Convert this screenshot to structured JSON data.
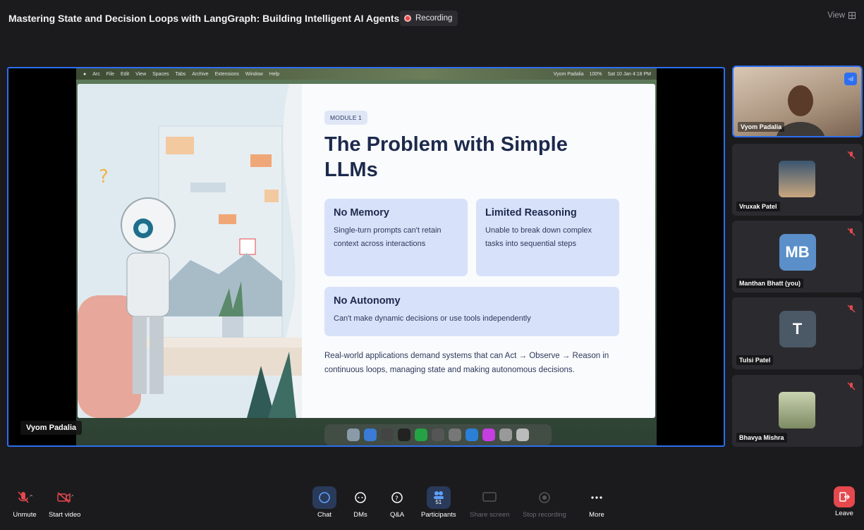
{
  "meeting": {
    "title": "Mastering State and Decision Loops with LangGraph: Building Intelligent AI Agents",
    "recording_label": "Recording",
    "view_label": "View"
  },
  "screen_share": {
    "menubar": {
      "items": [
        "Arc",
        "File",
        "Edit",
        "View",
        "Spaces",
        "Tabs",
        "Archive",
        "Extensions",
        "Window",
        "Help"
      ],
      "right_items": [
        "Vyom Padalia",
        "100%",
        "Sat 10 Jan 4:18 PM"
      ]
    },
    "slide": {
      "module_badge": "MODULE 1",
      "title": "The Problem with Simple LLMs",
      "cards": [
        {
          "title": "No Memory",
          "body": "Single-turn prompts can't retain context across interactions"
        },
        {
          "title": "Limited Reasoning",
          "body": "Unable to break down complex tasks into sequential steps"
        },
        {
          "title": "No Autonomy",
          "body": "Can't make dynamic decisions or use tools independently"
        }
      ],
      "body_text": "Real-world applications demand systems that can Act → Observe → Reason in continuous loops, managing state and making autonomous decisions."
    },
    "presenter_name": "Vyom Padalia"
  },
  "participants": [
    {
      "name": "Vyom Padalia",
      "type": "video",
      "speaking": true
    },
    {
      "name": "Vruxak Patel",
      "type": "photo",
      "muted": true
    },
    {
      "name": "Manthan Bhatt (you)",
      "type": "initials",
      "initials": "MB",
      "muted": true
    },
    {
      "name": "Tulsi Patel",
      "type": "initials",
      "initials": "T",
      "muted": true
    },
    {
      "name": "Bhavya Mishra",
      "type": "photo",
      "muted": true
    }
  ],
  "controls": {
    "unmute": "Unmute",
    "start_video": "Start video",
    "chat": "Chat",
    "dms": "DMs",
    "qa": "Q&A",
    "participants": "Participants",
    "participants_count": "51",
    "share_screen": "Share screen",
    "stop_recording": "Stop recording",
    "more": "More",
    "leave": "Leave"
  },
  "colors": {
    "accent": "#2d6ff0",
    "recording": "#e5484d",
    "leave": "#e5484d",
    "card": "#d7e1f9",
    "slide_title": "#1d2a4d"
  }
}
